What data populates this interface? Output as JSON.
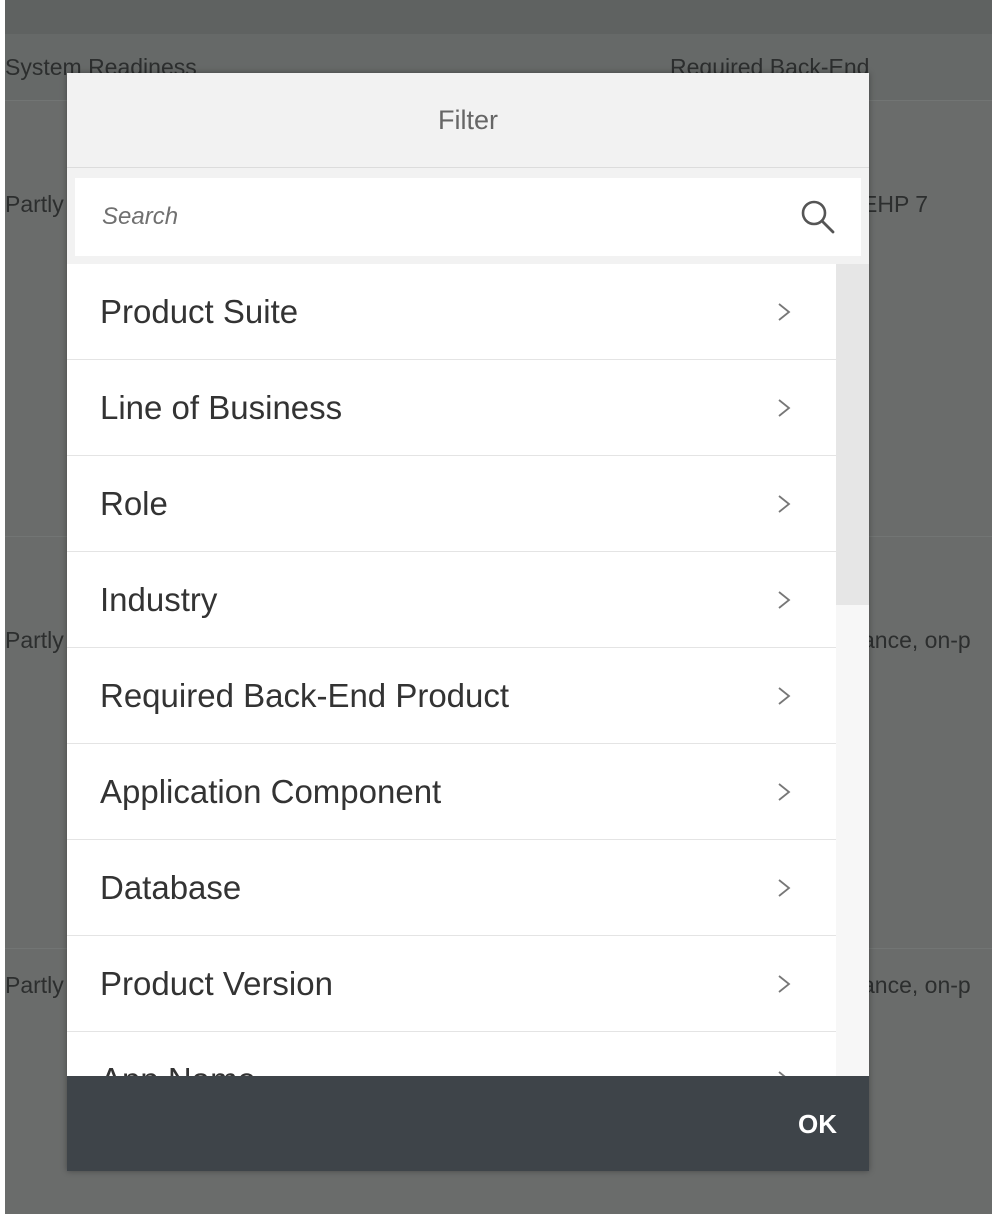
{
  "background": {
    "header": {
      "col1": "System Readiness",
      "col2": "Required Back-End"
    },
    "rows": [
      {
        "left": "Partly",
        "right": "EHP 7"
      },
      {
        "left": "Partly",
        "right": "ance, on-p"
      },
      {
        "left": "Partly",
        "right": "ance, on-p"
      }
    ]
  },
  "dialog": {
    "title": "Filter",
    "search": {
      "placeholder": "Search",
      "value": ""
    },
    "items": [
      {
        "label": "Product Suite"
      },
      {
        "label": "Line of Business"
      },
      {
        "label": "Role"
      },
      {
        "label": "Industry"
      },
      {
        "label": "Required Back-End Product"
      },
      {
        "label": "Application Component"
      },
      {
        "label": "Database"
      },
      {
        "label": "Product Version"
      },
      {
        "label": "App Name"
      }
    ],
    "ok_label": "OK"
  },
  "icons": {
    "search": "search-icon",
    "item_arrow": "chevron-right-icon"
  },
  "colors": {
    "overlay_page": "#6a6c6b",
    "dialog_header": "#f2f2f2",
    "footer": "#3e4449",
    "text": "#333333"
  }
}
